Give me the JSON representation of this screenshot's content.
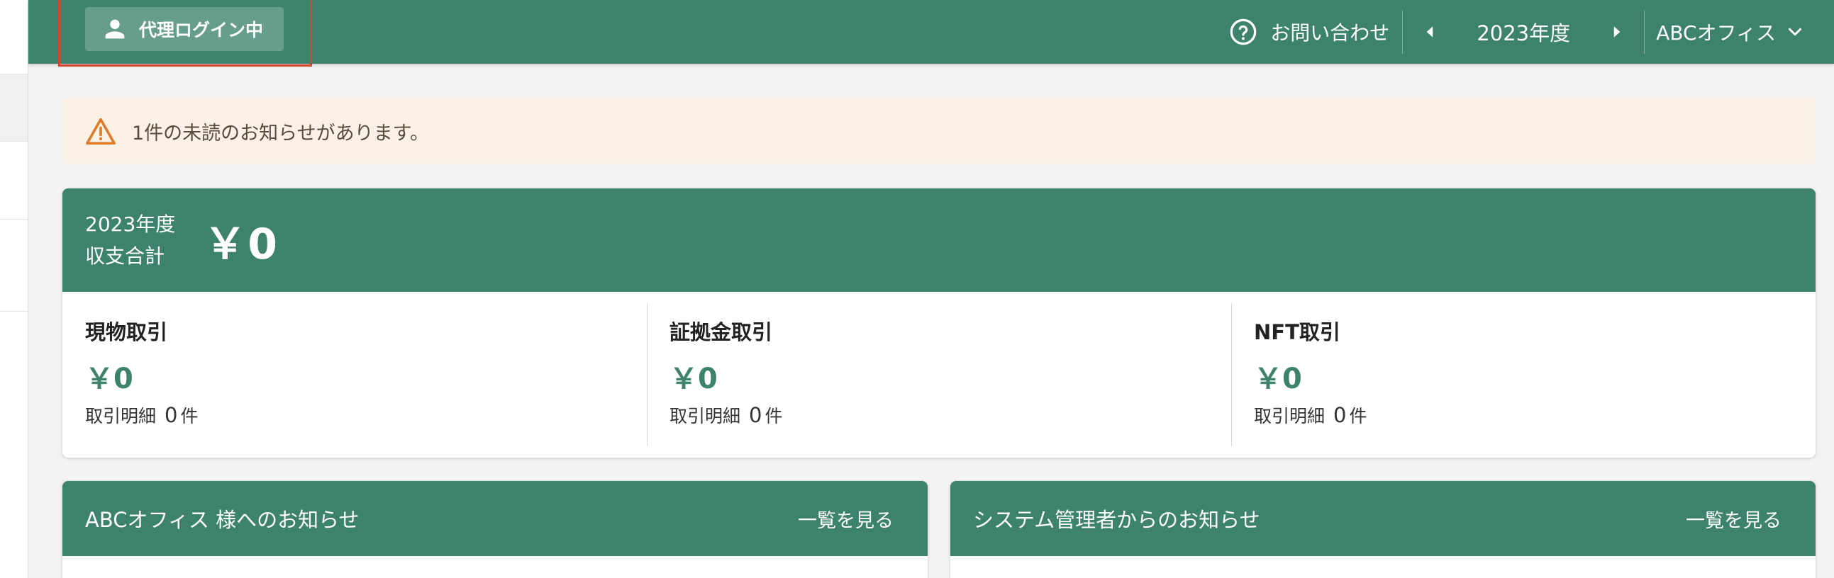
{
  "header": {
    "proxy_login_label": "代理ログイン中",
    "contact_label": "お問い合わせ",
    "fiscal_year": "2023年度",
    "office_name": "ABCオフィス"
  },
  "notice": {
    "message": "1件の未読のお知らせがあります。"
  },
  "summary": {
    "year_line": "2023年度",
    "total_line": "収支合計",
    "total_amount": "￥0",
    "columns": [
      {
        "title": "現物取引",
        "amount": "￥0",
        "detail_label": "取引明細",
        "count": "0",
        "unit": "件"
      },
      {
        "title": "証拠金取引",
        "amount": "￥0",
        "detail_label": "取引明細",
        "count": "0",
        "unit": "件"
      },
      {
        "title": "NFT取引",
        "amount": "￥0",
        "detail_label": "取引明細",
        "count": "0",
        "unit": "件"
      }
    ]
  },
  "cards": {
    "office_notice_title": "ABCオフィス 様へのお知らせ",
    "admin_notice_title": "システム管理者からのお知らせ",
    "view_all_label": "一覧を見る"
  },
  "colors": {
    "brand": "#3d826d",
    "notice_bg": "#fcf1e6",
    "warning": "#e07b2c",
    "highlight": "#d9422b"
  },
  "icons": [
    "person-icon",
    "help-icon",
    "caret-left-icon",
    "caret-right-icon",
    "chevron-down-icon",
    "warning-icon"
  ]
}
